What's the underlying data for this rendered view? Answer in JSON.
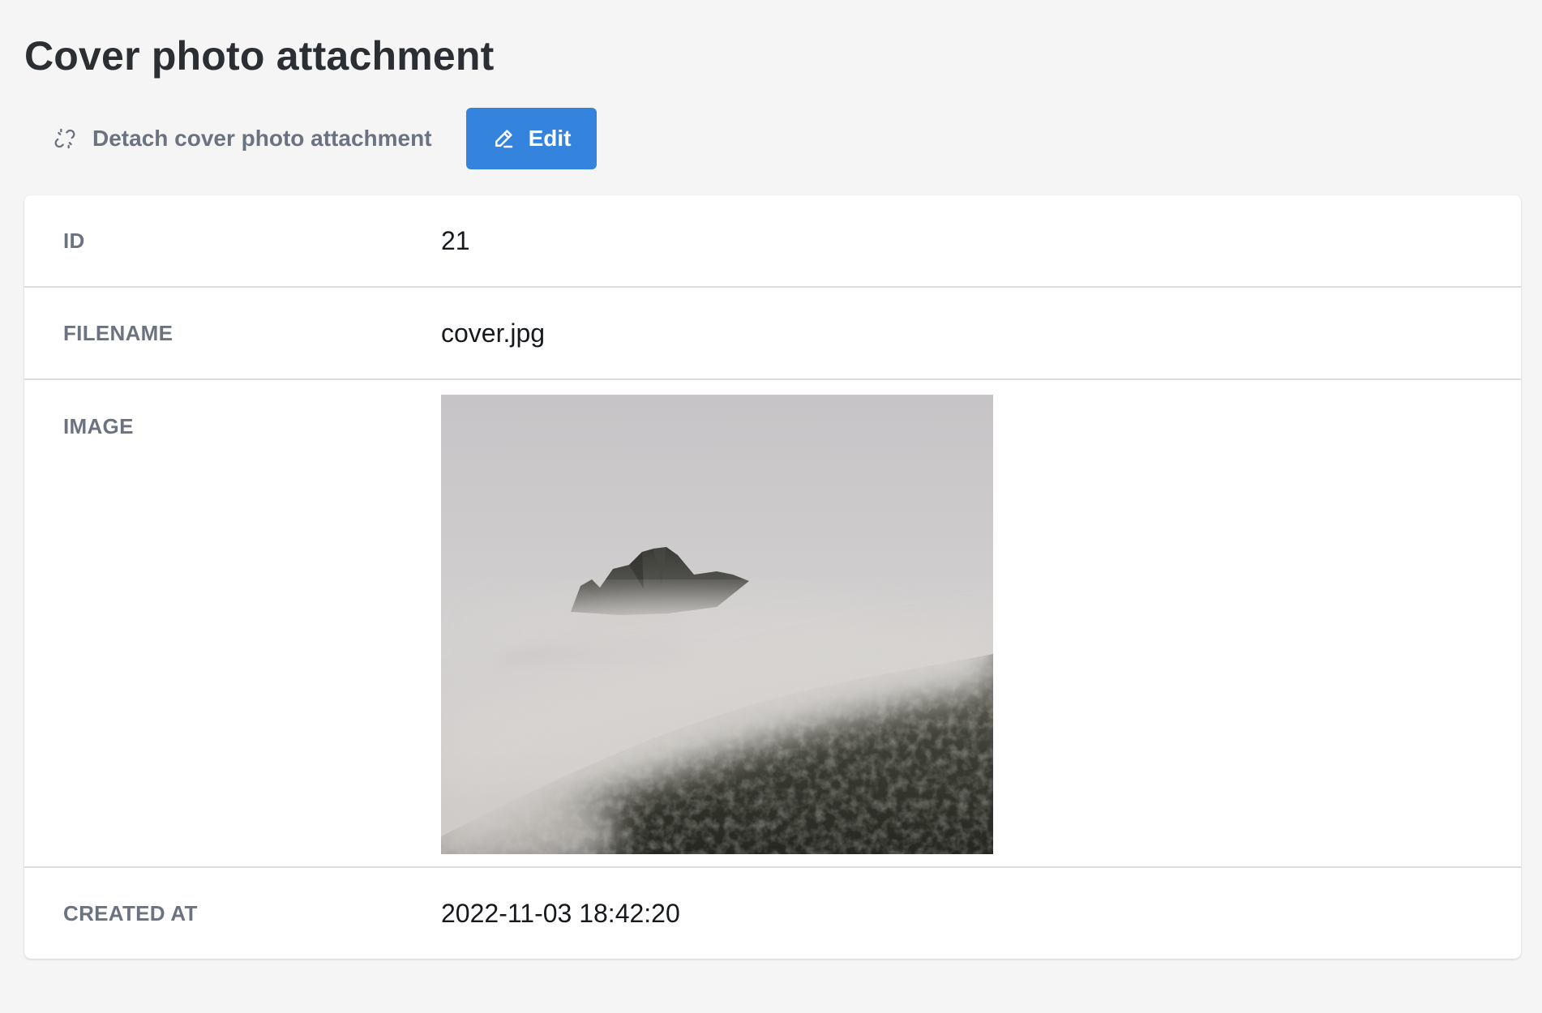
{
  "page": {
    "title": "Cover photo attachment"
  },
  "toolbar": {
    "detach_label": "Detach cover photo attachment",
    "detach_icon": "unlink-icon",
    "edit_label": "Edit",
    "edit_icon": "pencil-icon",
    "edit_color": "#3483dc"
  },
  "fields": {
    "id": {
      "label": "ID",
      "value": "21"
    },
    "filename": {
      "label": "FILENAME",
      "value": "cover.jpg"
    },
    "image": {
      "label": "IMAGE",
      "alt": "cover.jpg"
    },
    "created_at": {
      "label": "CREATED AT",
      "value": "2022-11-03 18:42:20"
    }
  }
}
